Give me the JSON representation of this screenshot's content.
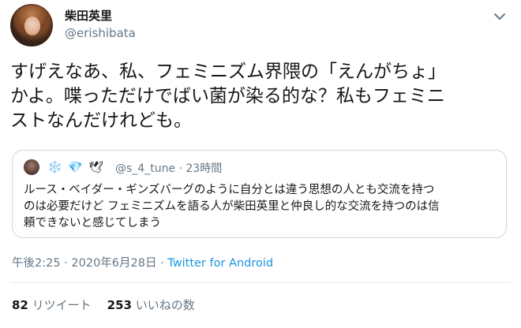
{
  "author": {
    "display_name": "柴田英里",
    "handle": "@erishibata"
  },
  "tweet": {
    "lines": [
      "すげえなあ、私、フェミニズム界隈の「えんがちょ」",
      "かよ。喋っただけでばい菌が染る的な？私もフェミニ",
      "ストなんだけれども。"
    ]
  },
  "quote": {
    "emojis": [
      "❄️",
      "💎",
      "🕊"
    ],
    "handle_time": "@s_4_tune · 23時間",
    "lines": [
      "ルース・ベイダー・ギンズバーグのように自分とは違う思想の人とも交流を持つ",
      "のは必要だけど フェミニズムを語る人が柴田英里と仲良し的な交流を持つのは信",
      "頼できないと感じてしまう"
    ]
  },
  "meta": {
    "timestamp": "午後2:25 · 2020年6月28日 · ",
    "source": "Twitter for Android"
  },
  "stats": {
    "retweets_count": "82",
    "retweets_label": "リツイート",
    "likes_count": "253",
    "likes_label": "いいねの数"
  },
  "colors": {
    "text": "#14171a",
    "secondary": "#657786",
    "link": "#1b95e0",
    "border": "#ccd6dd"
  },
  "icons": {
    "caret": "chevron-down-icon"
  }
}
